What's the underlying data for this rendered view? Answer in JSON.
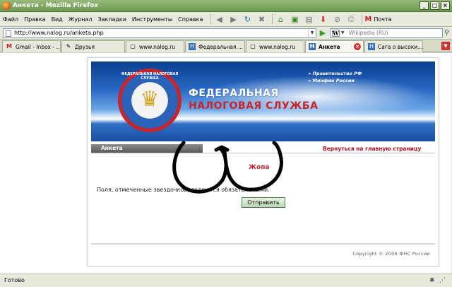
{
  "window": {
    "title": "Анкета - Mozilla Firefox",
    "controls": [
      "_",
      "□",
      "×"
    ]
  },
  "menu": {
    "items": [
      "Файл",
      "Правка",
      "Вид",
      "Журнал",
      "Закладки",
      "Инструменты",
      "Справка"
    ],
    "gmail_label": "Почта"
  },
  "toolbar": {
    "icons": [
      "back-icon",
      "forward-icon",
      "reload-icon",
      "stop-icon",
      "home-icon",
      "bookmark-icon",
      "feed-icon",
      "download-icon",
      "mail-icon"
    ]
  },
  "address": {
    "url": "http://www.nalog.ru/anketa.php",
    "search_engine": "W",
    "search_placeholder": "Wikipedia (RU)"
  },
  "tabs": [
    {
      "label": "Gmail - Inbox - ...",
      "icon": "M",
      "active": false
    },
    {
      "label": "Друзья",
      "icon": "✎",
      "active": false
    },
    {
      "label": "www.nalog.ru",
      "icon": "▢",
      "active": false
    },
    {
      "label": "Федеральная ...",
      "icon": "Н",
      "active": false
    },
    {
      "label": "www.nalog.ru",
      "icon": "▢",
      "active": false
    },
    {
      "label": "Анкета",
      "icon": "Н",
      "active": true
    },
    {
      "label": "Сага о высоки...",
      "icon": "Н",
      "active": false
    }
  ],
  "page": {
    "agency_line1": "ФЕДЕРАЛЬНАЯ",
    "agency_line2": "НАЛОГОВАЯ СЛУЖБА",
    "emblem_text": "ФЕДЕРАЛЬНАЯ НАЛОГОВАЯ СЛУЖБА",
    "top_link1": "» Правительство РФ",
    "top_link2": "» Минфин России",
    "section_title": "Анкета",
    "back_link": "Вернуться на главную страницу",
    "heading": "Жопа",
    "note": "Поля, отмеченные звездочкой, являются обязательными.",
    "submit_label": "Отправить",
    "copyright": "Copyright © 2006 ФНС России"
  },
  "status": {
    "text": "Готово"
  },
  "colors": {
    "titlebar": "#6e9a50",
    "heading_red": "#cc1f2a",
    "link_red": "#b01020",
    "banner_blue": "#2768c4"
  }
}
